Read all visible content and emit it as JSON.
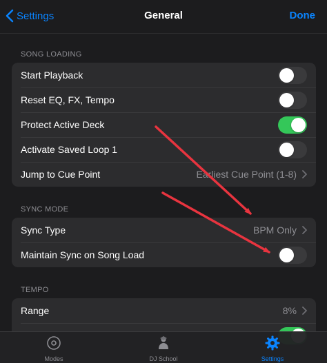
{
  "nav": {
    "back_label": "Settings",
    "title": "General",
    "done_label": "Done"
  },
  "sections": {
    "song_loading": {
      "header": "SONG LOADING",
      "rows": [
        {
          "label": "Start Playback",
          "toggle": "off"
        },
        {
          "label": "Reset EQ, FX, Tempo",
          "toggle": "off"
        },
        {
          "label": "Protect Active Deck",
          "toggle": "on"
        },
        {
          "label": "Activate Saved Loop 1",
          "toggle": "off"
        },
        {
          "label": "Jump to Cue Point",
          "value": "Earliest Cue Point (1-8)"
        }
      ]
    },
    "sync_mode": {
      "header": "SYNC MODE",
      "rows": [
        {
          "label": "Sync Type",
          "value": "BPM Only"
        },
        {
          "label": "Maintain Sync on Song Load",
          "toggle": "off"
        }
      ]
    },
    "tempo": {
      "header": "TEMPO",
      "rows": [
        {
          "label": "Range",
          "value": "8%"
        },
        {
          "label": "",
          "toggle": "on"
        }
      ]
    }
  },
  "tabbar": {
    "tabs": [
      {
        "label": "Modes",
        "icon": "disc-icon"
      },
      {
        "label": "DJ School",
        "icon": "dj-school-icon"
      },
      {
        "label": "Settings",
        "icon": "gear-icon",
        "active": true
      }
    ]
  },
  "colors": {
    "accent": "#0a84ff",
    "toggle_on": "#34c759",
    "annotation_arrow": "#e8343f"
  }
}
